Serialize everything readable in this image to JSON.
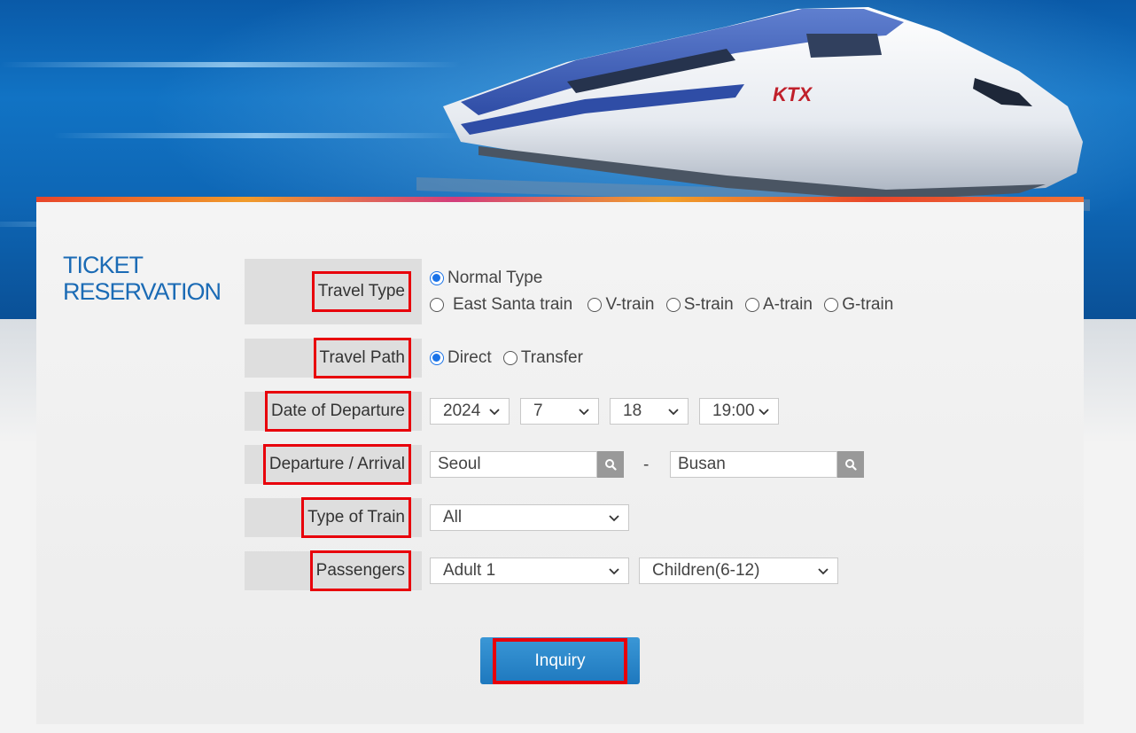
{
  "header": {
    "heading_line1": "TICKET",
    "heading_line2": "RESERVATION",
    "train_logo": "KTX"
  },
  "form": {
    "travel_type": {
      "label": "Travel Type",
      "options": [
        "Normal Type",
        "East Santa train",
        "V-train",
        "S-train",
        "A-train",
        "G-train"
      ],
      "selected": "Normal Type"
    },
    "travel_path": {
      "label": "Travel Path",
      "options": [
        "Direct",
        "Transfer"
      ],
      "selected": "Direct"
    },
    "date_of_departure": {
      "label": "Date of Departure",
      "year": "2024",
      "month": "7",
      "day": "18",
      "time": "19:00"
    },
    "departure_arrival": {
      "label": "Departure / Arrival",
      "departure": "Seoul",
      "separator": "-",
      "arrival": "Busan"
    },
    "type_of_train": {
      "label": "Type of Train",
      "selected": "All"
    },
    "passengers": {
      "label": "Passengers",
      "adult": "Adult 1",
      "children": "Children(6-12)"
    }
  },
  "actions": {
    "inquiry_label": "Inquiry"
  },
  "colors": {
    "accent_blue": "#1b6bb5",
    "highlight_red": "#e8000b",
    "button_blue": "#2787c9",
    "radio_blue": "#1a73e8"
  }
}
